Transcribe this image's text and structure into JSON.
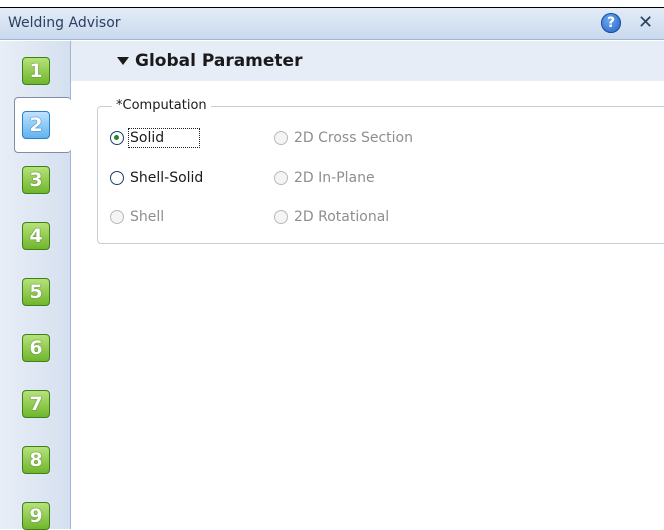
{
  "window": {
    "title": "Welding Advisor",
    "help_glyph": "?",
    "close_glyph": "✕"
  },
  "steps": [
    "1",
    "2",
    "3",
    "4",
    "5",
    "6",
    "7",
    "8",
    "9"
  ],
  "active_step": "2",
  "section": {
    "title": "Global Parameter"
  },
  "computation": {
    "legend": "*Computation",
    "options": {
      "solid": {
        "label": "Solid",
        "checked": true,
        "enabled": true
      },
      "shell_solid": {
        "label": "Shell-Solid",
        "checked": false,
        "enabled": true
      },
      "shell": {
        "label": "Shell",
        "checked": false,
        "enabled": false
      },
      "cross_section": {
        "label": "2D Cross Section",
        "checked": false,
        "enabled": false
      },
      "in_plane": {
        "label": "2D In-Plane",
        "checked": false,
        "enabled": false
      },
      "rotational": {
        "label": "2D Rotational",
        "checked": false,
        "enabled": false
      }
    }
  },
  "colors": {
    "titlebar": "#c9d9ee",
    "step_green": "#6fb62b",
    "step_active_blue": "#5fb3f0",
    "selected_dot": "#1f8a2a"
  }
}
